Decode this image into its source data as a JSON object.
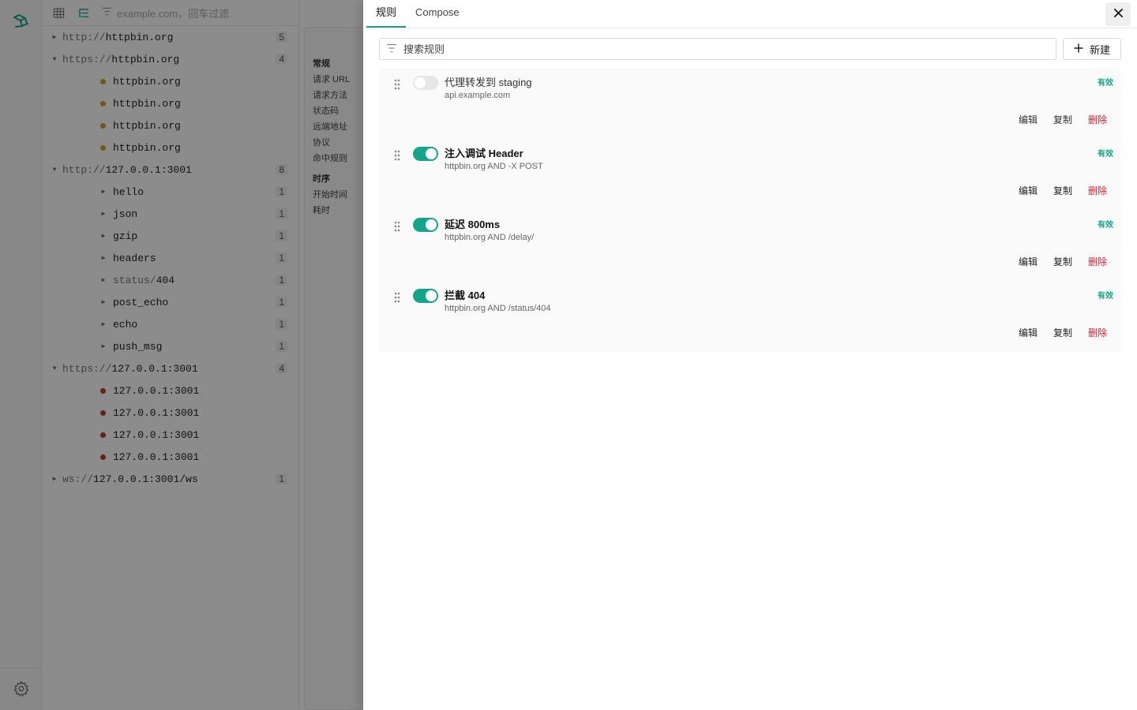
{
  "toolbar": {
    "filter_placeholder": "example.com，回车过滤"
  },
  "tree": [
    {
      "kind": "group",
      "expanded": false,
      "scheme": "http://",
      "host": "httpbin.org",
      "count": "5"
    },
    {
      "kind": "group",
      "expanded": true,
      "scheme": "https://",
      "host": "httpbin.org",
      "count": "4"
    },
    {
      "kind": "leaf",
      "dot": "y",
      "label": "httpbin.org"
    },
    {
      "kind": "leaf",
      "dot": "y",
      "label": "httpbin.org"
    },
    {
      "kind": "leaf",
      "dot": "y",
      "label": "httpbin.org"
    },
    {
      "kind": "leaf",
      "dot": "y",
      "label": "httpbin.org"
    },
    {
      "kind": "group",
      "expanded": true,
      "scheme": "http://",
      "host": "127.0.0.1:3001",
      "count": "8"
    },
    {
      "kind": "path",
      "label": "hello",
      "count": "1"
    },
    {
      "kind": "path",
      "label": "json",
      "count": "1"
    },
    {
      "kind": "path",
      "label": "gzip",
      "count": "1"
    },
    {
      "kind": "path",
      "label": "headers",
      "count": "1"
    },
    {
      "kind": "path",
      "label": "status/404",
      "count": "1",
      "muted_prefix": "status/",
      "rest": "404"
    },
    {
      "kind": "path",
      "label": "post_echo",
      "count": "1"
    },
    {
      "kind": "path",
      "label": "echo",
      "count": "1"
    },
    {
      "kind": "path",
      "label": "push_msg",
      "count": "1"
    },
    {
      "kind": "group",
      "expanded": true,
      "scheme": "https://",
      "host": "127.0.0.1:3001",
      "count": "4"
    },
    {
      "kind": "leaf",
      "dot": "r",
      "label": "127.0.0.1:3001"
    },
    {
      "kind": "leaf",
      "dot": "r",
      "label": "127.0.0.1:3001"
    },
    {
      "kind": "leaf",
      "dot": "r",
      "label": "127.0.0.1:3001"
    },
    {
      "kind": "leaf",
      "dot": "r",
      "label": "127.0.0.1:3001"
    },
    {
      "kind": "group",
      "expanded": false,
      "scheme": "ws://",
      "host": "127.0.0.1:3001/ws",
      "count": "1"
    }
  ],
  "detail": {
    "section_general": "常规",
    "items_general": [
      "请求 URL",
      "请求方法",
      "状态码",
      "远端地址",
      "协议",
      "命中规则"
    ],
    "section_timing": "时序",
    "items_timing": [
      "开始时间",
      "耗时"
    ]
  },
  "drawer": {
    "tabs": [
      "规则",
      "Compose"
    ],
    "active_tab": 0,
    "search_placeholder": "搜索规则",
    "new_label": "新建",
    "rules": [
      {
        "title": "代理转发到 staging",
        "desc": "api.example.com",
        "enabled": false,
        "status": "有效"
      },
      {
        "title": "注入调试 Header",
        "desc": "httpbin.org AND -X POST",
        "enabled": true,
        "status": "有效"
      },
      {
        "title": "延迟 800ms",
        "desc": "httpbin.org AND /delay/",
        "enabled": true,
        "status": "有效"
      },
      {
        "title": "拦截 404",
        "desc": "httpbin.org AND /status/404",
        "enabled": true,
        "status": "有效"
      }
    ],
    "actions": {
      "edit": "编辑",
      "copy": "复制",
      "delete": "删除"
    }
  },
  "colors": {
    "accent": "#17a589",
    "danger": "#e5162b",
    "warning_dot": "#d4a017",
    "error_dot": "#c0392b"
  }
}
